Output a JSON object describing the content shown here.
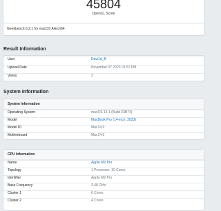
{
  "score": {
    "value": "45804",
    "label": "OpenCL Score",
    "version": "Geekbench 6.2.1 for macOS AArch64"
  },
  "result_information": {
    "heading": "Result Information",
    "rows": [
      {
        "key": "User",
        "value": "Davi1d_B"
      },
      {
        "key": "Upload Date",
        "value": "November 07 2023 01:57 PM"
      },
      {
        "key": "Views",
        "value": "3"
      }
    ]
  },
  "system_information": {
    "heading": "System Information",
    "system": {
      "title": "System Information",
      "rows": [
        {
          "key": "Operating System",
          "value": "macOS 14.1 (Build 23B74)"
        },
        {
          "key": "Model",
          "value": "MacBook Pro (14-inch, 2023)"
        },
        {
          "key": "Model ID",
          "value": "Mac14,9"
        },
        {
          "key": "Motherboard",
          "value": "Mac14,9"
        }
      ]
    },
    "cpu": {
      "title": "CPU Information",
      "rows": [
        {
          "key": "Name",
          "value": "Apple M2 Pro"
        },
        {
          "key": "Topology",
          "value": "1 Processor, 10 Cores"
        },
        {
          "key": "Identifier",
          "value": "Apple M2 Pro"
        },
        {
          "key": "Base Frequency",
          "value": "3.48 GHz"
        },
        {
          "key": "Cluster 1",
          "value": "6 Cores"
        },
        {
          "key": "Cluster 2",
          "value": "4 Cores"
        }
      ]
    }
  }
}
